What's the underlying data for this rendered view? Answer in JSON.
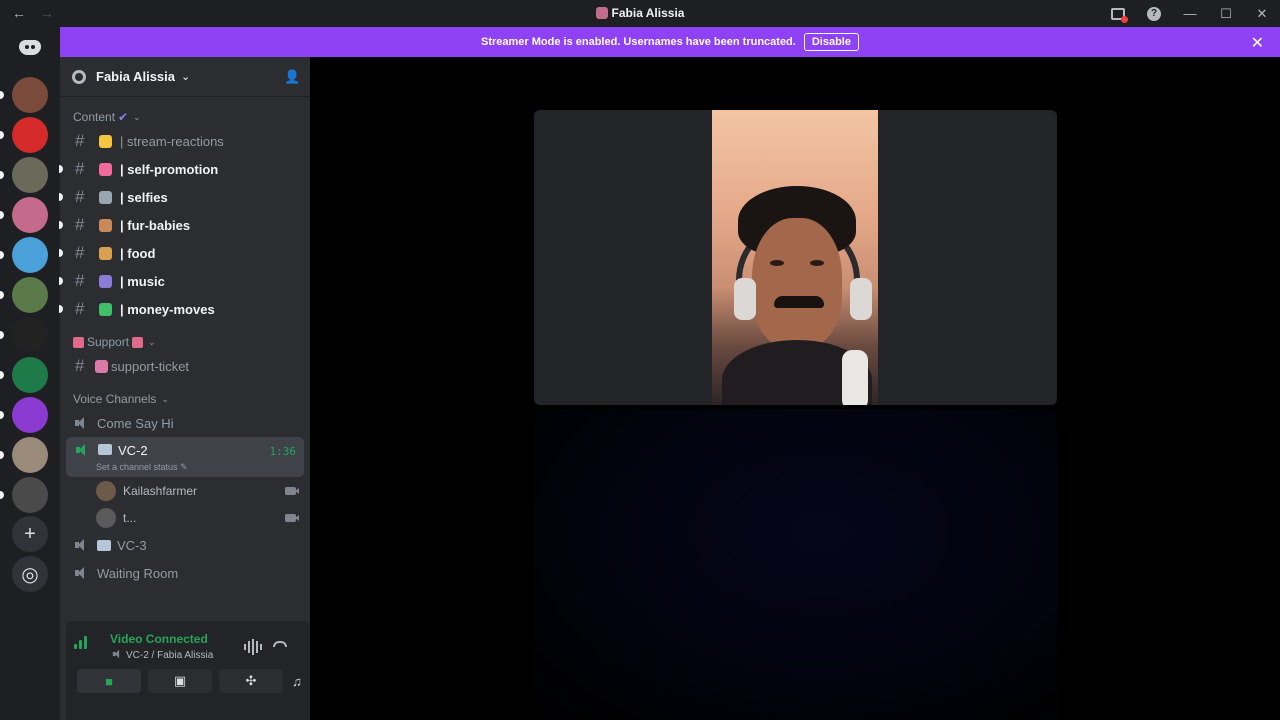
{
  "window": {
    "title": "Fabia Alissia",
    "back_glyph": "←",
    "forward_glyph": "→",
    "help_glyph": "?",
    "minimize_glyph": "—",
    "maximize_glyph": "☐",
    "close_glyph": "✕"
  },
  "banner": {
    "message": "Streamer Mode is enabled. Usernames have been truncated.",
    "disable_label": "Disable",
    "close_glyph": "✕"
  },
  "server": {
    "name": "Fabia Alissia",
    "chevron": "⌄",
    "invite_glyph": "👤"
  },
  "categories": {
    "content": "Content",
    "support": "Support",
    "voice": "Voice Channels",
    "chevron": "⌄"
  },
  "text_channels": [
    {
      "name": "| stream-reactions",
      "emoji_color": "#f5c542",
      "unread": false
    },
    {
      "name": "| self-promotion",
      "emoji_color": "#f06a9a",
      "unread": true
    },
    {
      "name": "| selfies",
      "emoji_color": "#9aa6b2",
      "unread": true
    },
    {
      "name": "| fur-babies",
      "emoji_color": "#c98a5a",
      "unread": true
    },
    {
      "name": "| food",
      "emoji_color": "#d9a050",
      "unread": true
    },
    {
      "name": "| music",
      "emoji_color": "#8a7bd6",
      "unread": true
    },
    {
      "name": "| money-moves",
      "emoji_color": "#3fbf6a",
      "unread": true
    }
  ],
  "support_channel": {
    "name": "support-ticket",
    "emoji_color": "#d97aa8"
  },
  "hash_glyph": "#",
  "voice_channels": {
    "come_say_hi": "Come Say Hi",
    "vc2": {
      "name": "VC-2",
      "timer": "1:36",
      "status": "Set a channel status"
    },
    "vc3": "VC-3",
    "waiting_room": "Waiting Room"
  },
  "members": [
    {
      "name": "Kailashfarmer",
      "avatar_color": "#6e5a4a"
    },
    {
      "name": "t...",
      "avatar_color": "#5a5a5a"
    }
  ],
  "voice_panel": {
    "title": "Video Connected",
    "subtitle": "VC-2 / Fabia Alissia",
    "camera_glyph": "■",
    "screen_glyph": "▣",
    "activity_glyph": "✣",
    "soundboard_glyph": "♫"
  },
  "rail": {
    "add_glyph": "+",
    "discover_glyph": "◎",
    "servers": [
      {
        "color": "#7a4a3a"
      },
      {
        "color": "#d42a2a"
      },
      {
        "color": "#6a6a5a"
      },
      {
        "color": "#c46a8a"
      },
      {
        "color": "#4aa0d8"
      },
      {
        "color": "#5a7a4a"
      },
      {
        "color": "#222222"
      },
      {
        "color": "#1f7a4a"
      },
      {
        "color": "#8a3ad0"
      },
      {
        "color": "#9a8a7a"
      },
      {
        "color": "#4a4a4a"
      }
    ]
  },
  "colors": {
    "accent_purple": "#8f41f5",
    "connected_green": "#23a55a",
    "sidebar_bg": "#2b2d31",
    "rail_bg": "#1e1f22"
  }
}
